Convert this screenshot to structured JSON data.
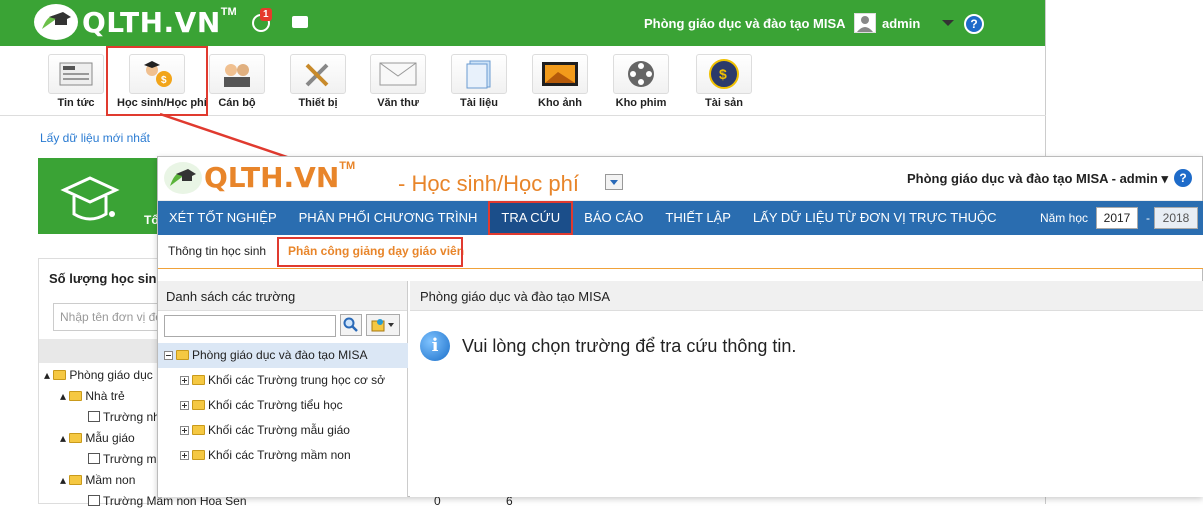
{
  "back": {
    "logo": "QLTH.VN",
    "logo_tm": "TM",
    "notif_count": "1",
    "org_name": "Phòng giáo dục và đào tạo MISA",
    "user": "admin",
    "modules": [
      {
        "label": "Tin tức",
        "icon": "newspaper-icon"
      },
      {
        "label": "Học sinh/Học phí",
        "icon": "student-fee-icon"
      },
      {
        "label": "Cán bộ",
        "icon": "staff-icon"
      },
      {
        "label": "Thiết bị",
        "icon": "tools-icon"
      },
      {
        "label": "Văn thư",
        "icon": "mail-icon"
      },
      {
        "label": "Tài liệu",
        "icon": "document-icon"
      },
      {
        "label": "Kho ảnh",
        "icon": "photo-icon"
      },
      {
        "label": "Kho phim",
        "icon": "film-reel-icon"
      },
      {
        "label": "Tài sản",
        "icon": "asset-icon"
      }
    ],
    "refresh_link": "Lấy dữ liệu mới nhất",
    "tile_word": "Tổ",
    "panel_title": "Số lượng học sinh",
    "search_placeholder": "Nhập tên đơn vị để",
    "tree": [
      "Phòng giáo dục",
      "Nhà trẻ",
      "Trường nh",
      "Mẫu giáo",
      "Trường mẫ",
      "Mầm non",
      "Trường Mầm non Hoa Sen"
    ],
    "row_values": [
      "0",
      "6"
    ]
  },
  "front": {
    "logo": "QLTH.VN",
    "logo_tm": "TM",
    "module_title": "- Học sinh/Học phí",
    "org_user": "Phòng giáo dục và đào tạo MISA - admin",
    "nav": [
      {
        "label": "XÉT TỐT NGHIỆP"
      },
      {
        "label": "PHÂN PHỐI CHƯƠNG TRÌNH"
      },
      {
        "label": "TRA CỨU"
      },
      {
        "label": "BÁO CÁO"
      },
      {
        "label": "THIẾT LẬP"
      },
      {
        "label": "LẤY DỮ LIỆU TỪ ĐƠN VỊ TRỰC THUỘC"
      }
    ],
    "year_label": "Năm học",
    "year_from": "2017",
    "year_to": "2018",
    "subtabs": {
      "info": "Thông tin học sinh",
      "assign": "Phân công giảng dạy giáo viên"
    },
    "left_title": "Danh sách các trường",
    "tree": [
      {
        "label": "Phòng giáo dục và đào tạo MISA"
      },
      {
        "label": "Khối các Trường trung học cơ sở"
      },
      {
        "label": "Khối các Trường tiểu học"
      },
      {
        "label": "Khối các Trường mẫu giáo"
      },
      {
        "label": "Khối các Trường mầm non"
      }
    ],
    "right_title": "Phòng giáo dục và đào tạo MISA",
    "message": "Vui lòng chọn trường để tra cứu thông tin."
  },
  "colors": {
    "green": "#3aa335",
    "blue_nav": "#2a6db0",
    "orange": "#e8852a",
    "highlight_red": "#e03a2f"
  }
}
